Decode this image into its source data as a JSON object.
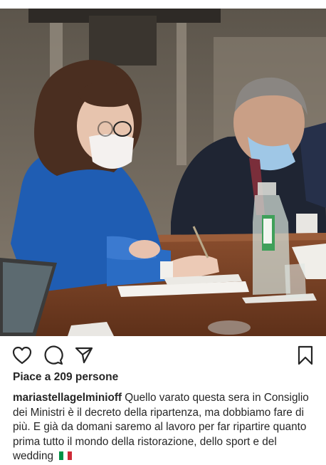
{
  "post": {
    "photo_alt": "",
    "likes_text": "Piace a 209 persone",
    "username": "mariastellagelminioff",
    "caption": "Quello varato questa sera in Consiglio dei Ministri è il decreto della ripartenza, ma dobbiamo fare di più. E già da domani saremo al lavoro per far ripartire quanto prima tutto il mondo della ristorazione, dello sport e del wedding",
    "caption_emoji": "italy-flag"
  },
  "actions": {
    "like_icon": "heart-icon",
    "comment_icon": "comment-icon",
    "share_icon": "paper-plane-icon",
    "save_icon": "bookmark-icon"
  },
  "colors": {
    "text": "#262626",
    "flag_green": "#009246",
    "flag_white": "#ffffff",
    "flag_red": "#ce2b37"
  }
}
